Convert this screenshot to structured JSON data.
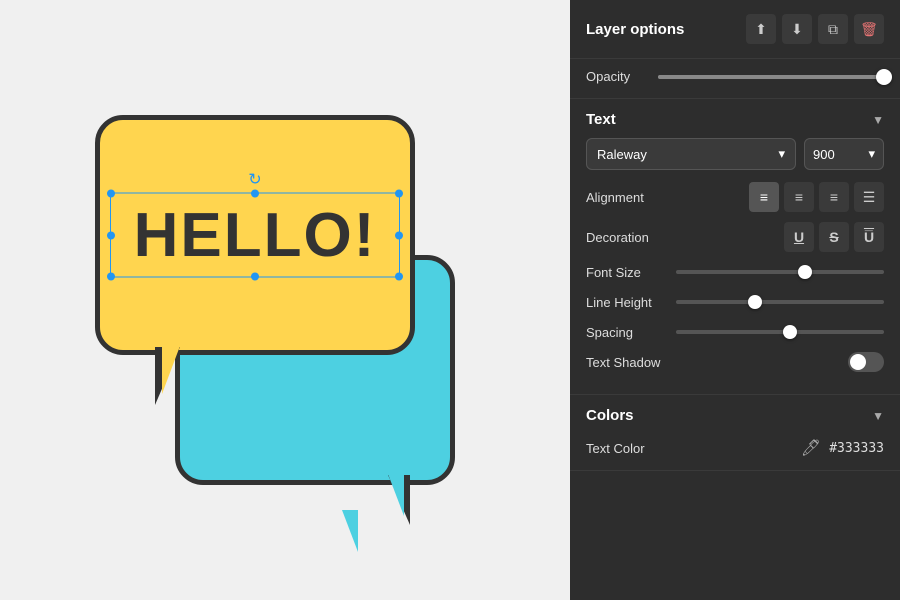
{
  "canvas": {
    "background": "#f0f0f0"
  },
  "layer_options": {
    "title": "Layer options",
    "icons": [
      "align-top",
      "align-bottom",
      "duplicate",
      "delete"
    ]
  },
  "opacity": {
    "label": "Opacity",
    "value": 100,
    "percent": 100
  },
  "text_section": {
    "title": "Text",
    "font": {
      "family": "Raleway",
      "weight": "900"
    },
    "alignment": {
      "label": "Alignment",
      "options": [
        "align-left",
        "align-center",
        "align-right",
        "justify"
      ],
      "active": 0
    },
    "decoration": {
      "label": "Decoration",
      "options": [
        "underline",
        "strikethrough",
        "overline"
      ]
    },
    "font_size": {
      "label": "Font Size",
      "value": 65,
      "percent": 62
    },
    "line_height": {
      "label": "Line Height",
      "value": 1.2,
      "percent": 38
    },
    "spacing": {
      "label": "Spacing",
      "value": 2,
      "percent": 55
    },
    "text_shadow": {
      "label": "Text Shadow",
      "enabled": false
    }
  },
  "colors_section": {
    "title": "Colors",
    "text_color": {
      "label": "Text Color",
      "hex": "#333333"
    }
  },
  "artwork": {
    "hello_text": "HELLO!"
  }
}
